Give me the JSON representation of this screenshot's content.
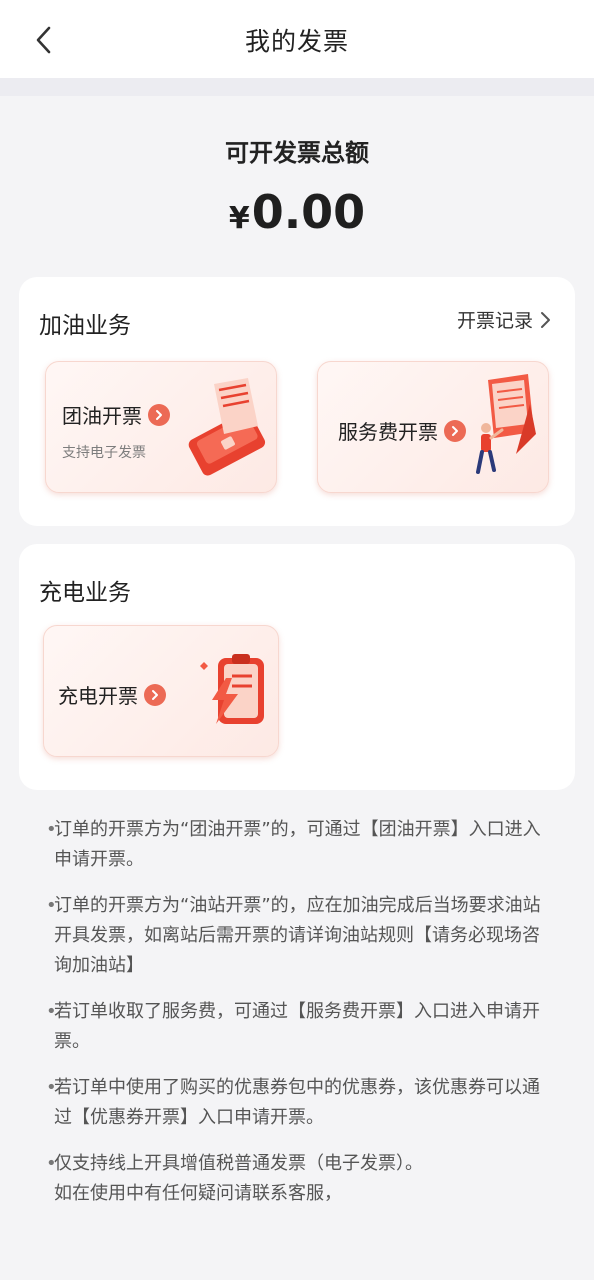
{
  "header": {
    "title": "我的发票",
    "back_icon": "chevron-left-icon"
  },
  "summary": {
    "label": "可开发票总额",
    "currency": "¥",
    "amount": "0.00"
  },
  "fuel_section": {
    "title": "加油业务",
    "records_label": "开票记录",
    "tiles": [
      {
        "label": "团油开票",
        "sub": "支持电子发票",
        "illustration": "receipt-icon"
      },
      {
        "label": "服务费开票",
        "illustration": "person-with-document-icon"
      }
    ]
  },
  "charge_section": {
    "title": "充电业务",
    "tiles": [
      {
        "label": "充电开票",
        "illustration": "lightning-clipboard-icon"
      }
    ]
  },
  "notes": [
    "订单的开票方为“团油开票”的，可通过【团油开票】入口进入申请开票。",
    "订单的开票方为“油站开票”的，应在加油完成后当场要求油站开具发票，如离站后需开票的请详询油站规则【请务必现场咨询加油站】",
    "若订单收取了服务费，可通过【服务费开票】入口进入申请开票。",
    "若订单中使用了购买的优惠券包中的优惠券，该优惠券可以通过【优惠券开票】入口申请开票。",
    "仅支持线上开具增值税普通发票（电子发票）。"
  ],
  "note_extra": "如在使用中有任何疑问请联系客服，",
  "colors": {
    "accent": "#ec6a55",
    "background": "#f4f4f6",
    "card": "#ffffff"
  }
}
